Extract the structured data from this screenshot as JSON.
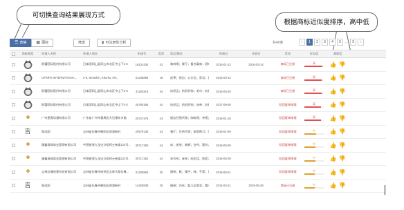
{
  "callouts": {
    "left": "可切换查询结果展现方式",
    "right": "根据商标近似度排序，高中低"
  },
  "toolbar": {
    "views": [
      {
        "label": "表格",
        "icon": "list-icon",
        "active": true
      },
      {
        "label": "图标",
        "icon": "grid-icon",
        "active": false
      }
    ],
    "filter_label": "筛选",
    "analysis_label": "可注册性分析",
    "total": "共40条",
    "pages": [
      "1",
      "2",
      "3",
      "4",
      "5",
      "...",
      "9"
    ]
  },
  "table": {
    "headers": [
      "商标图案",
      "申请人名称",
      "申请人地址",
      "申请号",
      "类别",
      "商品/服务",
      "申请日",
      "注册日",
      "状态",
      "近似度",
      "满意度"
    ],
    "rows": [
      {
        "img": "cat",
        "app": "欧蕾国际股份有限公司",
        "addr": "日本国冈山县冈山市北区中山下2-3",
        "no": "16131434",
        "cls": "43",
        "goods": "咖啡馆；餐厅；备办宴席；酒吧服务",
        "date": "2015-01-12",
        "regdate": "2016-03-14",
        "status": "商标已注册",
        "sim": "高",
        "simv": 0.92,
        "simcolor": "#e05050"
      },
      {
        "img": "cat",
        "app": "OTRIPS INTERNATIONA...",
        "addr": "2-9, Setoshin, Kita-ku, Ok...",
        "no": "31346866",
        "cls": "18",
        "goods": "皮革；钱包；公文包；背包；旅行箱",
        "date": "2015-03-14",
        "regdate": "",
        "status": "商标已注册",
        "sim": "高",
        "simv": 0.9,
        "simcolor": "#e05050"
      },
      {
        "img": "cat",
        "app": "欧蕾国际股份有限公司",
        "addr": "日本国冈山县冈山市北区中山下2-3",
        "no": "31180319",
        "cls": "24",
        "goods": "纺织品；纺织织物；毛巾；纺织品毛巾",
        "date": "2015-05-20",
        "regdate": "",
        "status": "商标已注册",
        "sim": "高",
        "simv": 0.88,
        "simcolor": "#e05050"
      },
      {
        "img": "cat",
        "app": "欧蕾国际股份有限公司",
        "addr": "日本国冈山县冈山市北区中山下2-3",
        "no": "25780166",
        "cls": "24",
        "goods": "纺织品；纺织织物；床单；纺织品毛巾",
        "date": "2017-09-08",
        "regdate": "",
        "status": "驳回复审审理",
        "sim": "高",
        "simv": 0.86,
        "simcolor": "#e05050"
      },
      {
        "img": "figure",
        "app": "广州星客动漫有限公司",
        "addr": "广东省广州市番禺区大石镇东乡路",
        "no": "20727476",
        "cls": "43",
        "goods": "饭店住宿代理；咖啡馆；茶馆；餐馆",
        "date": "2018-01-16",
        "regdate": "",
        "status": "驳回复审审理",
        "sim": "高",
        "simv": 0.84,
        "simcolor": "#e05050"
      },
      {
        "img": "glyph",
        "glyph": "吉",
        "app": "郭成翔",
        "addr": "吉林省长春市朝阳区南湖新村",
        "no": "20570135",
        "cls": "43",
        "goods": "餐厅；住所代理；旅馆预订；咖啡馆",
        "date": "2016-01-09",
        "regdate": "",
        "status": "驳回复审审理",
        "sim": "中",
        "simv": 0.6,
        "simcolor": "#e0a030"
      },
      {
        "img": "figure",
        "app": "康鑫福禄商业管理有限公司",
        "addr": "中国香港九龙尖沙咀柯士甸道122号...",
        "no": "30717260",
        "cls": "24",
        "goods": "床；床垫；被褥；台布；窗帘；坐垫",
        "date": "2018-05-09",
        "regdate": "",
        "status": "驳回复审审理",
        "sim": "中",
        "simv": 0.58,
        "simcolor": "#e0a030"
      },
      {
        "img": "figure",
        "app": "康鑫福禄商业管理有限公司",
        "addr": "中国香港九龙尖沙咀柯士甸道122号...",
        "no": "30717281",
        "cls": "24",
        "goods": "毛巾布；床单；纺织品；枕套；被罩",
        "date": "2018-05-09",
        "regdate": "",
        "status": "驳回复审审理",
        "sim": "中",
        "simv": 0.56,
        "simcolor": "#e0a030"
      },
      {
        "img": "figure",
        "app": "吉林动漫创意科技有限公司",
        "addr": "吉林省长春市南关区吉林大路长春...",
        "no": "31333863",
        "cls": "25",
        "goods": "服装；鞋；帽子；袜；手套；领带",
        "date": "2018-06-01",
        "regdate": "",
        "status": "驳回复审审理",
        "sim": "中",
        "simv": 0.54,
        "simcolor": "#e0a030"
      },
      {
        "img": "glyph",
        "glyph": "吉",
        "app": "郭成翔",
        "addr": "吉林省长春市朝阳区南湖新村",
        "no": "14425838",
        "cls": "25",
        "goods": "服装；内衣；婴儿全套衣；帽子",
        "date": "2014-04-21",
        "regdate": "2015-05-28",
        "status": "商标已注册",
        "sim": "中",
        "simv": 0.52,
        "simcolor": "#e0a030"
      }
    ]
  }
}
